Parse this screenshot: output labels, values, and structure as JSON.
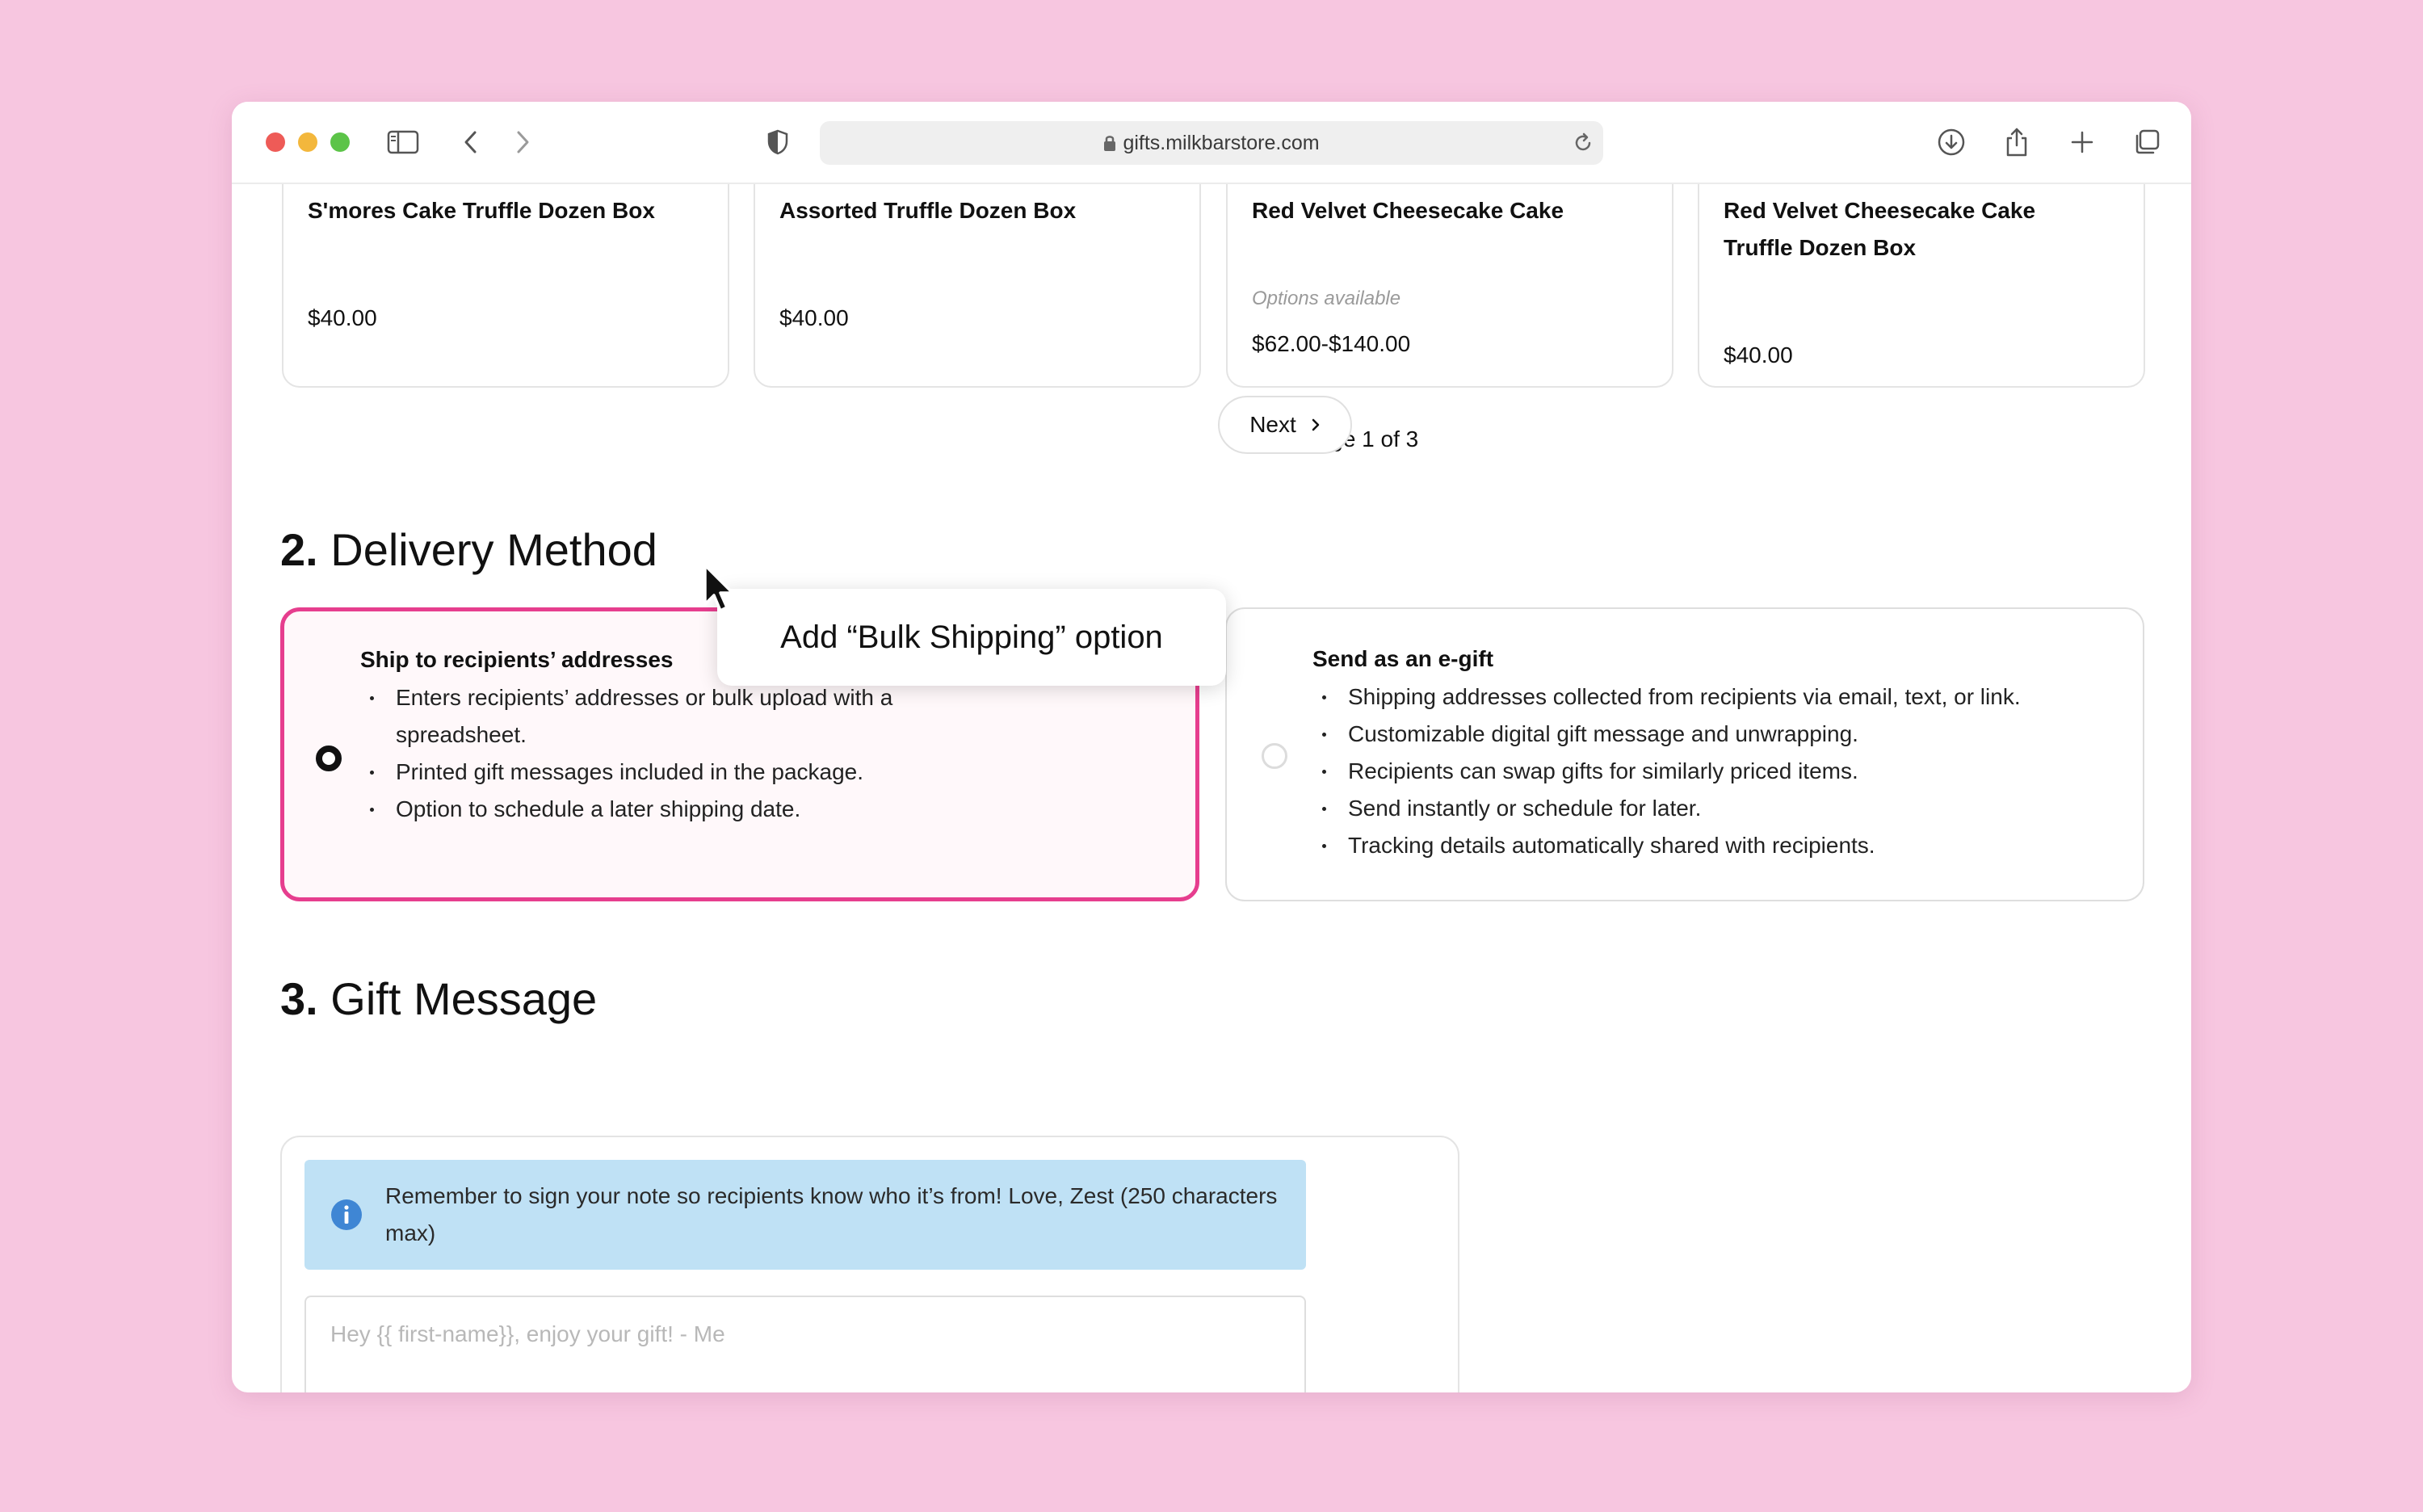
{
  "browser": {
    "url": "gifts.milkbarstore.com"
  },
  "products": [
    {
      "name": "S'mores Cake Truffle Dozen Box",
      "options": "",
      "price": "$40.00"
    },
    {
      "name": "Assorted Truffle Dozen Box",
      "options": "",
      "price": "$40.00"
    },
    {
      "name": "Red Velvet Cheesecake Cake",
      "options": "Options available",
      "price": "$62.00-$140.00"
    },
    {
      "name": "Red Velvet Cheesecake Cake Truffle Dozen Box",
      "options": "",
      "price": "$40.00"
    }
  ],
  "pagination": {
    "page_text": "Page 1 of 3",
    "next_label": "Next"
  },
  "delivery": {
    "number": "2.",
    "title": "Delivery Method",
    "options": [
      {
        "title": "Ship to recipients’ addresses",
        "selected": true,
        "bullets": [
          "Enters recipients’ addresses or bulk upload with a spreadsheet.",
          "Printed gift messages included in the package.",
          "Option to schedule a later shipping date."
        ]
      },
      {
        "title": "Send as an e-gift",
        "selected": false,
        "bullets": [
          "Shipping addresses collected from recipients via email, text, or link.",
          "Customizable digital gift message and unwrapping.",
          "Recipients can swap gifts for similarly priced items.",
          "Send instantly or schedule for later.",
          "Tracking details automatically shared with recipients."
        ]
      }
    ]
  },
  "tooltip": {
    "text": "Add “Bulk Shipping” option"
  },
  "gift_message": {
    "number": "3.",
    "title": "Gift Message",
    "info": "Remember to sign your note so recipients know who it’s from! Love, Zest (250 characters max)",
    "placeholder": "Hey {{ first-name}}, enjoy your gift! - Me"
  },
  "colors": {
    "background": "#f7c6e0",
    "accent": "#e63e8e",
    "info_bg": "#bfe1f5",
    "info_icon": "#3f86d4"
  }
}
